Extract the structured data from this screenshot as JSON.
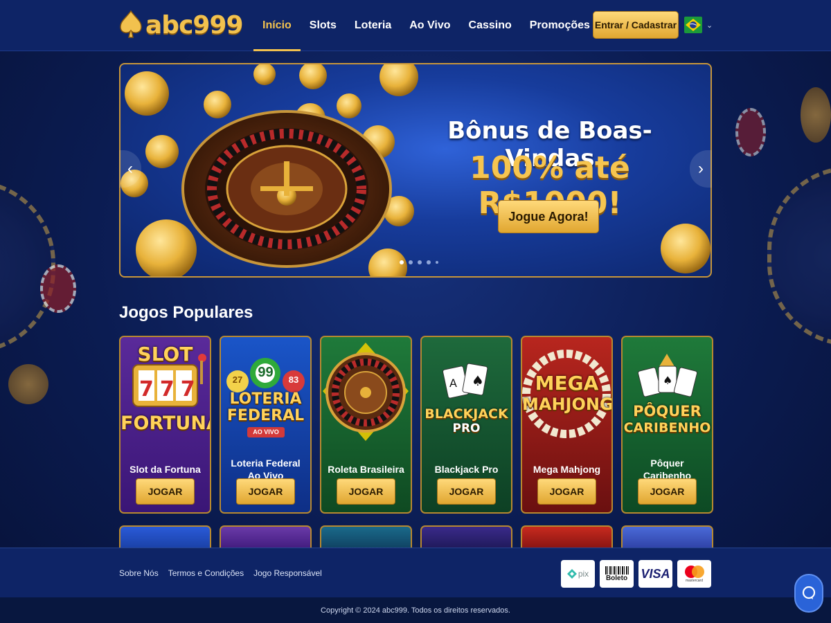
{
  "header": {
    "logo_text": "abc999",
    "nav": [
      {
        "label": "Início",
        "active": true
      },
      {
        "label": "Slots",
        "active": false
      },
      {
        "label": "Loteria",
        "active": false
      },
      {
        "label": "Ao Vivo",
        "active": false
      },
      {
        "label": "Cassino",
        "active": false
      },
      {
        "label": "Promoções",
        "active": false
      }
    ],
    "login_label": "Entrar / Cadastrar",
    "language_icon": "brazil-flag-icon"
  },
  "banner": {
    "title": "Bônus de Boas-Vindas",
    "subtitle": "100% até R$1000!",
    "cta_label": "Jogue Agora!",
    "prev_arrow": "‹",
    "next_arrow": "›",
    "slide_count": 5,
    "active_slide": 1
  },
  "games": {
    "title": "Jogos Populares",
    "items": [
      {
        "logo_line1": "SLOT",
        "logo_line2": "FORTUNA",
        "reels": "777",
        "name": "Slot da Fortuna",
        "button": "JOGAR"
      },
      {
        "balls": [
          "27",
          "99",
          "83"
        ],
        "logo_line1": "LOTERIA",
        "logo_line2": "FEDERAL",
        "logo_tag": "AO VIVO",
        "name": "Loteria Federal Ao Vivo",
        "button": "JOGAR"
      },
      {
        "name": "Roleta Brasileira",
        "button": "JOGAR"
      },
      {
        "logo_line1": "BLACKJACK",
        "logo_line2": "PRO",
        "name": "Blackjack Pro",
        "button": "JOGAR"
      },
      {
        "logo_line1": "MEGA",
        "logo_line2": "MAHJONG",
        "name": "Mega Mahjong",
        "button": "JOGAR"
      },
      {
        "logo_line1": "PÔQUER",
        "logo_line2": "CARIBENHO",
        "name": "Pôquer Caribenho",
        "button": "JOGAR"
      }
    ]
  },
  "footer": {
    "links": [
      "Sobre Nós",
      "Termos e Condições",
      "Jogo Responsável"
    ],
    "payments": [
      {
        "label": "pix",
        "icon": "pix-icon"
      },
      {
        "label": "Boleto",
        "icon": "boleto-icon"
      },
      {
        "label": "VISA",
        "icon": "visa-icon"
      },
      {
        "label": "mastercard",
        "icon": "mastercard-icon"
      }
    ],
    "copyright": "Copyright © 2024 abc999. Todos os direitos reservados."
  },
  "colors": {
    "accent_gold": "#f2c14e",
    "header_bg": "#0e2466",
    "page_bg": "#0b1c52"
  }
}
